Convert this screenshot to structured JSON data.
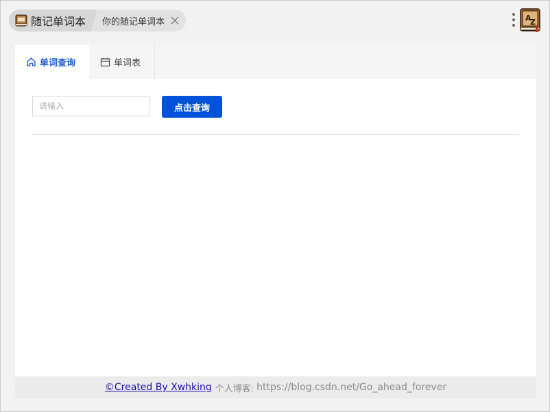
{
  "breadcrumb": {
    "app_label": "随记单词本",
    "page_label": "你的随记单词本",
    "app_icon": "book-icon",
    "close_icon": "close-icon"
  },
  "toolbar": {
    "menu_icon": "kebab-menu-icon",
    "corner_icon": "dictionary-az-icon"
  },
  "tabs": [
    {
      "label": "单词查询",
      "icon": "home-icon",
      "active": true
    },
    {
      "label": "单词表",
      "icon": "calendar-icon",
      "active": false
    }
  ],
  "search": {
    "placeholder": "请输入",
    "value": "",
    "button_label": "点击查询"
  },
  "footer": {
    "link_text": "©Created By Xwhking",
    "blog_label": "个人博客:",
    "blog_url": "https://blog.csdn.net/Go_ahead_forever"
  },
  "colors": {
    "accent": "#0052d9",
    "active_tab_text": "#1e5bd1",
    "link": "#1a0dab"
  }
}
